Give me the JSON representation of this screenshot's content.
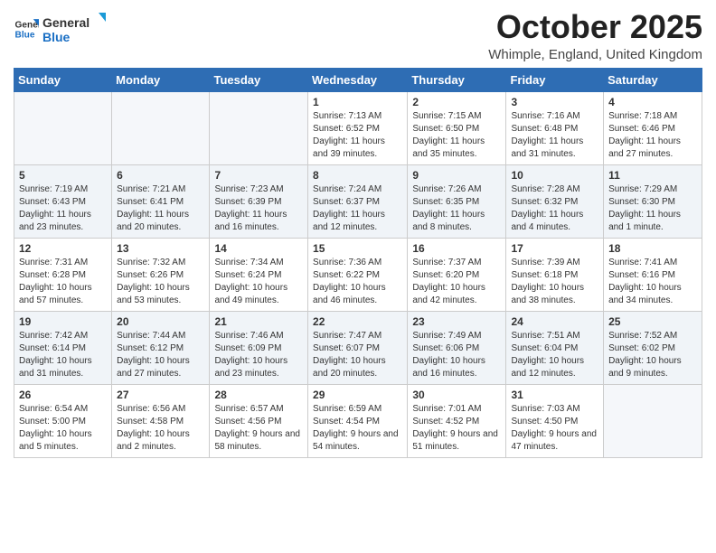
{
  "header": {
    "logo_line1": "General",
    "logo_line2": "Blue",
    "month_title": "October 2025",
    "location": "Whimple, England, United Kingdom"
  },
  "weekdays": [
    "Sunday",
    "Monday",
    "Tuesday",
    "Wednesday",
    "Thursday",
    "Friday",
    "Saturday"
  ],
  "weeks": [
    [
      {
        "day": "",
        "info": ""
      },
      {
        "day": "",
        "info": ""
      },
      {
        "day": "",
        "info": ""
      },
      {
        "day": "1",
        "info": "Sunrise: 7:13 AM\nSunset: 6:52 PM\nDaylight: 11 hours and 39 minutes."
      },
      {
        "day": "2",
        "info": "Sunrise: 7:15 AM\nSunset: 6:50 PM\nDaylight: 11 hours and 35 minutes."
      },
      {
        "day": "3",
        "info": "Sunrise: 7:16 AM\nSunset: 6:48 PM\nDaylight: 11 hours and 31 minutes."
      },
      {
        "day": "4",
        "info": "Sunrise: 7:18 AM\nSunset: 6:46 PM\nDaylight: 11 hours and 27 minutes."
      }
    ],
    [
      {
        "day": "5",
        "info": "Sunrise: 7:19 AM\nSunset: 6:43 PM\nDaylight: 11 hours and 23 minutes."
      },
      {
        "day": "6",
        "info": "Sunrise: 7:21 AM\nSunset: 6:41 PM\nDaylight: 11 hours and 20 minutes."
      },
      {
        "day": "7",
        "info": "Sunrise: 7:23 AM\nSunset: 6:39 PM\nDaylight: 11 hours and 16 minutes."
      },
      {
        "day": "8",
        "info": "Sunrise: 7:24 AM\nSunset: 6:37 PM\nDaylight: 11 hours and 12 minutes."
      },
      {
        "day": "9",
        "info": "Sunrise: 7:26 AM\nSunset: 6:35 PM\nDaylight: 11 hours and 8 minutes."
      },
      {
        "day": "10",
        "info": "Sunrise: 7:28 AM\nSunset: 6:32 PM\nDaylight: 11 hours and 4 minutes."
      },
      {
        "day": "11",
        "info": "Sunrise: 7:29 AM\nSunset: 6:30 PM\nDaylight: 11 hours and 1 minute."
      }
    ],
    [
      {
        "day": "12",
        "info": "Sunrise: 7:31 AM\nSunset: 6:28 PM\nDaylight: 10 hours and 57 minutes."
      },
      {
        "day": "13",
        "info": "Sunrise: 7:32 AM\nSunset: 6:26 PM\nDaylight: 10 hours and 53 minutes."
      },
      {
        "day": "14",
        "info": "Sunrise: 7:34 AM\nSunset: 6:24 PM\nDaylight: 10 hours and 49 minutes."
      },
      {
        "day": "15",
        "info": "Sunrise: 7:36 AM\nSunset: 6:22 PM\nDaylight: 10 hours and 46 minutes."
      },
      {
        "day": "16",
        "info": "Sunrise: 7:37 AM\nSunset: 6:20 PM\nDaylight: 10 hours and 42 minutes."
      },
      {
        "day": "17",
        "info": "Sunrise: 7:39 AM\nSunset: 6:18 PM\nDaylight: 10 hours and 38 minutes."
      },
      {
        "day": "18",
        "info": "Sunrise: 7:41 AM\nSunset: 6:16 PM\nDaylight: 10 hours and 34 minutes."
      }
    ],
    [
      {
        "day": "19",
        "info": "Sunrise: 7:42 AM\nSunset: 6:14 PM\nDaylight: 10 hours and 31 minutes."
      },
      {
        "day": "20",
        "info": "Sunrise: 7:44 AM\nSunset: 6:12 PM\nDaylight: 10 hours and 27 minutes."
      },
      {
        "day": "21",
        "info": "Sunrise: 7:46 AM\nSunset: 6:09 PM\nDaylight: 10 hours and 23 minutes."
      },
      {
        "day": "22",
        "info": "Sunrise: 7:47 AM\nSunset: 6:07 PM\nDaylight: 10 hours and 20 minutes."
      },
      {
        "day": "23",
        "info": "Sunrise: 7:49 AM\nSunset: 6:06 PM\nDaylight: 10 hours and 16 minutes."
      },
      {
        "day": "24",
        "info": "Sunrise: 7:51 AM\nSunset: 6:04 PM\nDaylight: 10 hours and 12 minutes."
      },
      {
        "day": "25",
        "info": "Sunrise: 7:52 AM\nSunset: 6:02 PM\nDaylight: 10 hours and 9 minutes."
      }
    ],
    [
      {
        "day": "26",
        "info": "Sunrise: 6:54 AM\nSunset: 5:00 PM\nDaylight: 10 hours and 5 minutes."
      },
      {
        "day": "27",
        "info": "Sunrise: 6:56 AM\nSunset: 4:58 PM\nDaylight: 10 hours and 2 minutes."
      },
      {
        "day": "28",
        "info": "Sunrise: 6:57 AM\nSunset: 4:56 PM\nDaylight: 9 hours and 58 minutes."
      },
      {
        "day": "29",
        "info": "Sunrise: 6:59 AM\nSunset: 4:54 PM\nDaylight: 9 hours and 54 minutes."
      },
      {
        "day": "30",
        "info": "Sunrise: 7:01 AM\nSunset: 4:52 PM\nDaylight: 9 hours and 51 minutes."
      },
      {
        "day": "31",
        "info": "Sunrise: 7:03 AM\nSunset: 4:50 PM\nDaylight: 9 hours and 47 minutes."
      },
      {
        "day": "",
        "info": ""
      }
    ]
  ]
}
